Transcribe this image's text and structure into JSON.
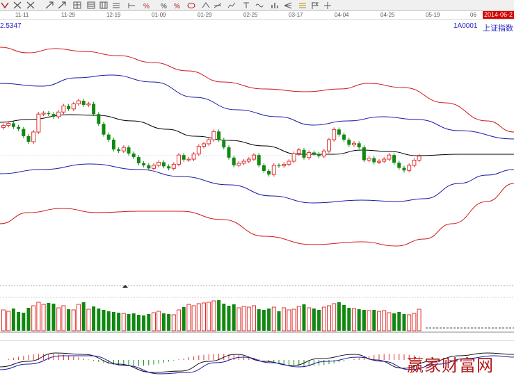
{
  "toolbar": {
    "icons": [
      "history-icon",
      "ruler-icon",
      "undo-icon",
      "redo-icon",
      "cross-icon",
      "grid-icon",
      "compare-icon",
      "table-icon",
      "layers-icon",
      "dash-icon",
      "percent-icon",
      "percent-plain-icon",
      "percent-red-icon",
      "ellipse-icon",
      "arrow-up-icon",
      "signal-icon",
      "chart-icon",
      "text-icon",
      "wave-icon",
      "bar-icon",
      "fork-icon",
      "gold-icon",
      "flag-icon",
      "crosshair-icon"
    ]
  },
  "timeline": {
    "dates": [
      "11-11",
      "11-29",
      "12-19",
      "01-09",
      "01-29",
      "02-25",
      "03-17",
      "04-04",
      "04-25",
      "05-19",
      "06"
    ],
    "current": "2014-06-2"
  },
  "header": {
    "price": "2.5347",
    "code": "1A0001",
    "name": "上证指数"
  },
  "watermark": "赢家财富网",
  "colors": {
    "up": "#e03030",
    "down": "#118811",
    "upper_band": "#d01818",
    "mid_band": "#1818a8",
    "ma": "#000000"
  },
  "chart_data": {
    "type": "candlestick",
    "title": "",
    "x_tick_labels": [
      "11-11",
      "11-29",
      "12-19",
      "01-09",
      "01-29",
      "02-25",
      "03-17",
      "04-04",
      "04-25",
      "05-19",
      "06"
    ],
    "closes": [
      2168,
      2172,
      2165,
      2161,
      2147,
      2136,
      2155,
      2190,
      2192,
      2190,
      2185,
      2194,
      2206,
      2200,
      2210,
      2216,
      2208,
      2210,
      2190,
      2171,
      2150,
      2140,
      2121,
      2118,
      2125,
      2113,
      2106,
      2094,
      2090,
      2084,
      2090,
      2096,
      2088,
      2084,
      2092,
      2110,
      2101,
      2102,
      2112,
      2127,
      2132,
      2140,
      2156,
      2140,
      2125,
      2105,
      2090,
      2094,
      2098,
      2102,
      2110,
      2090,
      2079,
      2072,
      2090,
      2089,
      2092,
      2098,
      2113,
      2120,
      2105,
      2115,
      2112,
      2108,
      2118,
      2140,
      2160,
      2150,
      2140,
      2130,
      2133,
      2125,
      2100,
      2104,
      2096,
      2098,
      2102,
      2110,
      2095,
      2085,
      2080,
      2090,
      2100,
      2108
    ],
    "volumes": [
      30,
      28,
      32,
      27,
      26,
      33,
      36,
      41,
      38,
      40,
      39,
      33,
      36,
      31,
      30,
      38,
      41,
      31,
      35,
      32,
      30,
      28,
      27,
      26,
      25,
      24,
      25,
      23,
      22,
      24,
      26,
      28,
      25,
      24,
      23,
      30,
      34,
      38,
      36,
      39,
      40,
      41,
      43,
      44,
      39,
      36,
      38,
      33,
      35,
      34,
      36,
      31,
      30,
      32,
      34,
      28,
      33,
      30,
      31,
      35,
      38,
      33,
      32,
      30,
      34,
      36,
      39,
      41,
      37,
      33,
      32,
      31,
      30,
      29,
      30,
      28,
      29,
      26,
      25,
      27,
      24,
      23,
      25,
      31
    ],
    "volume_ref_lines": [
      "dashed"
    ]
  }
}
